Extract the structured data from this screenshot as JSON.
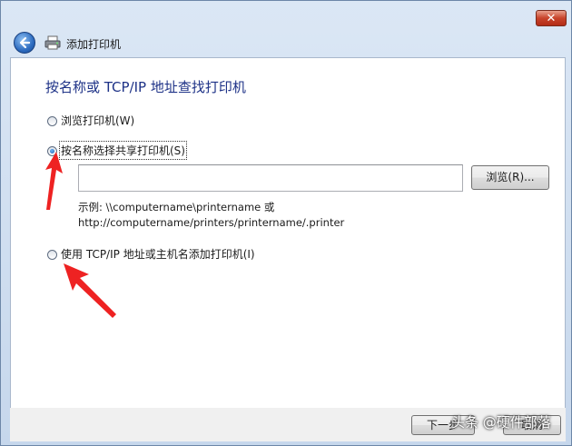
{
  "window": {
    "title": "添加打印机",
    "close_label": "✕"
  },
  "content": {
    "heading": "按名称或 TCP/IP 地址查找打印机",
    "options": [
      {
        "label": "浏览打印机(W)",
        "checked": false
      },
      {
        "label": "按名称选择共享打印机(S)",
        "checked": true
      },
      {
        "label": "使用 TCP/IP 地址或主机名添加打印机(I)",
        "checked": false
      }
    ],
    "share_name_input": {
      "value": "",
      "placeholder": ""
    },
    "browse_button_label": "浏览(R)...",
    "example_line1": "示例: \\\\computername\\printername 或",
    "example_line2": "http://computername/printers/printername/.printer"
  },
  "footer": {
    "next_label": "下一步",
    "cancel_label": "取消"
  },
  "watermark": "头条 @硬件部落",
  "annotations": {
    "arrow_color": "#ee2222"
  },
  "icons": {
    "back": "back-arrow-icon",
    "printer": "printer-icon",
    "close": "close-icon"
  }
}
